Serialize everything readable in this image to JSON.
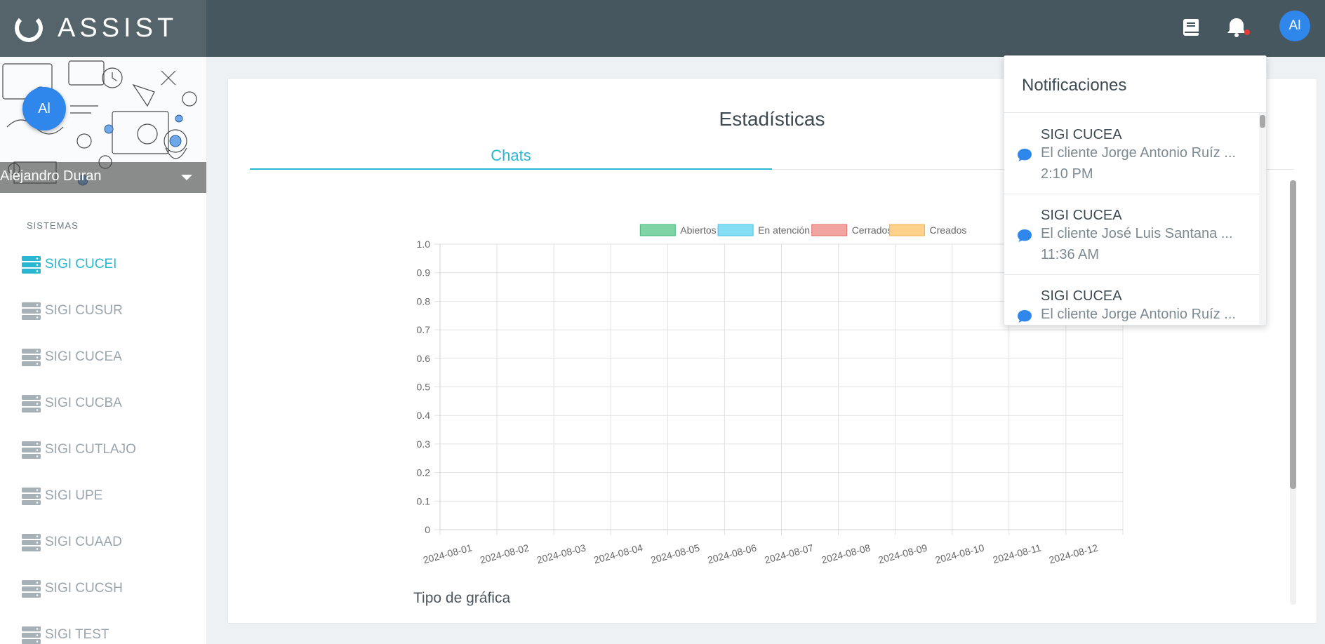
{
  "brand": {
    "name": "ASSIST"
  },
  "header": {
    "icons": [
      "book-icon",
      "bell-icon"
    ],
    "user_initials": "Al"
  },
  "profile": {
    "initials": "Al",
    "name": "Alejandro Duran"
  },
  "sidebar": {
    "section_label": "SISTEMAS",
    "items": [
      {
        "label": "SIGI CUCEI",
        "active": true
      },
      {
        "label": "SIGI CUSUR",
        "active": false
      },
      {
        "label": "SIGI CUCEA",
        "active": false
      },
      {
        "label": "SIGI CUCBA",
        "active": false
      },
      {
        "label": "SIGI CUTLAJO",
        "active": false
      },
      {
        "label": "SIGI UPE",
        "active": false
      },
      {
        "label": "SIGI CUAAD",
        "active": false
      },
      {
        "label": "SIGI CUCSH",
        "active": false
      },
      {
        "label": "SIGI TEST",
        "active": false
      }
    ]
  },
  "main": {
    "title": "Estadísticas",
    "tabs": [
      {
        "label": "Chats",
        "active": true
      }
    ],
    "chart_type_label": "Tipo de gráfica"
  },
  "notifications": {
    "title": "Notificaciones",
    "items": [
      {
        "title": "SIGI CUCEA",
        "message": "El cliente Jorge Antonio Ruíz ...",
        "time": "2:10 PM"
      },
      {
        "title": "SIGI CUCEA",
        "message": "El cliente José Luis Santana ...",
        "time": "11:36 AM"
      },
      {
        "title": "SIGI CUCEA",
        "message": "El cliente Jorge Antonio Ruíz ...",
        "time": ""
      }
    ]
  },
  "colors": {
    "topbar": "#47575f",
    "accent": "#29b6d0",
    "avatar": "#2f86eb"
  },
  "chart_data": {
    "type": "bar",
    "categories": [
      "2024-08-01",
      "2024-08-02",
      "2024-08-03",
      "2024-08-04",
      "2024-08-05",
      "2024-08-06",
      "2024-08-07",
      "2024-08-08",
      "2024-08-09",
      "2024-08-10",
      "2024-08-11",
      "2024-08-12"
    ],
    "series": [
      {
        "name": "Abiertos",
        "color": "#7fd3a5",
        "border": "#3dbb7c",
        "values": [
          0,
          0,
          0,
          0,
          0,
          0,
          0,
          0,
          0,
          0,
          0,
          0
        ]
      },
      {
        "name": "En atención",
        "color": "#86def5",
        "border": "#41c3e6",
        "values": [
          0,
          0,
          0,
          0,
          0,
          0,
          0,
          0,
          0,
          0,
          0,
          0
        ]
      },
      {
        "name": "Cerrados",
        "color": "#f2a5a0",
        "border": "#e26f68",
        "values": [
          0,
          0,
          0,
          0,
          0,
          0,
          0,
          0,
          0,
          0,
          0,
          0
        ]
      },
      {
        "name": "Creados",
        "color": "#fdd18a",
        "border": "#f4b34a",
        "values": [
          0,
          0,
          0,
          0,
          0,
          0,
          0,
          0,
          0,
          0,
          0,
          0
        ]
      }
    ],
    "yticks": [
      "0",
      "0.1",
      "0.2",
      "0.3",
      "0.4",
      "0.5",
      "0.6",
      "0.7",
      "0.8",
      "0.9",
      "1.0"
    ],
    "ylim": [
      0,
      1
    ],
    "grid": true,
    "legend": "top"
  }
}
